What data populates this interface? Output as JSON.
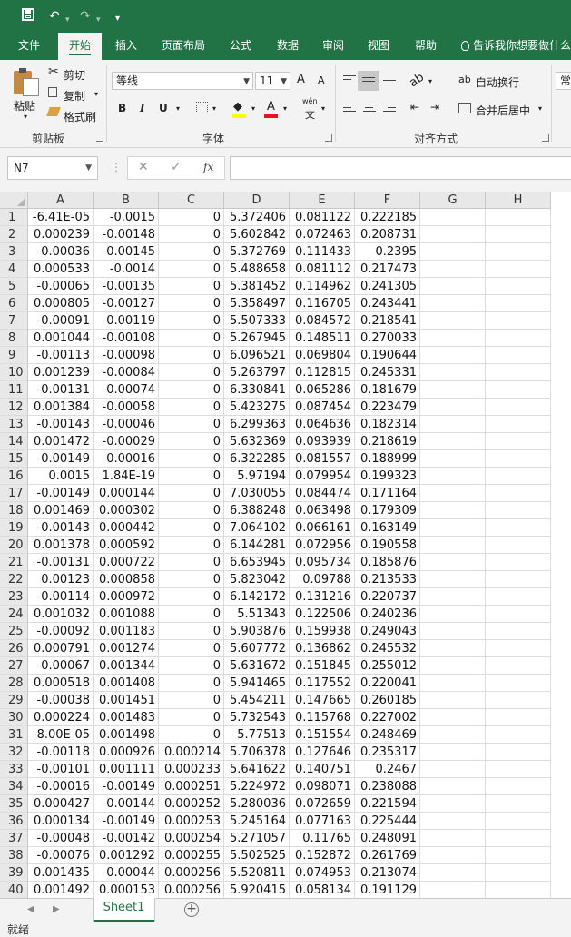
{
  "quick_access": {
    "undo": "↶",
    "redo": "↷",
    "customize": "▾"
  },
  "menu": {
    "tabs": [
      "文件",
      "开始",
      "插入",
      "页面布局",
      "公式",
      "数据",
      "审阅",
      "视图",
      "帮助"
    ],
    "active": "开始",
    "tell_me": "告诉我你想要做什么"
  },
  "ribbon": {
    "clipboard": {
      "paste": "粘贴",
      "cut": "剪切",
      "copy": "复制",
      "format_painter": "格式刷",
      "label": "剪贴板"
    },
    "font": {
      "name": "等线",
      "size": "11",
      "grow": "A",
      "shrink": "A",
      "bold": "B",
      "italic": "I",
      "underline": "U",
      "phonetic": "wén",
      "label": "字体"
    },
    "alignment": {
      "wrap_text": "自动换行",
      "merge_center": "合并后居中",
      "label": "对齐方式"
    },
    "number": {
      "format": "常规"
    }
  },
  "formula_bar": {
    "name_box": "N7",
    "cancel": "✕",
    "enter": "✓",
    "fx": "fx",
    "formula": ""
  },
  "grid": {
    "columns": [
      "A",
      "B",
      "C",
      "D",
      "E",
      "F",
      "G",
      "H"
    ],
    "rows": [
      [
        "-6.41E-05",
        "-0.0015",
        "0",
        "5.372406",
        "0.081122",
        "0.222185"
      ],
      [
        "0.000239",
        "-0.00148",
        "0",
        "5.602842",
        "0.072463",
        "0.208731"
      ],
      [
        "-0.00036",
        "-0.00145",
        "0",
        "5.372769",
        "0.111433",
        "0.2395"
      ],
      [
        "0.000533",
        "-0.0014",
        "0",
        "5.488658",
        "0.081112",
        "0.217473"
      ],
      [
        "-0.00065",
        "-0.00135",
        "0",
        "5.381452",
        "0.114962",
        "0.241305"
      ],
      [
        "0.000805",
        "-0.00127",
        "0",
        "5.358497",
        "0.116705",
        "0.243441"
      ],
      [
        "-0.00091",
        "-0.00119",
        "0",
        "5.507333",
        "0.084572",
        "0.218541"
      ],
      [
        "0.001044",
        "-0.00108",
        "0",
        "5.267945",
        "0.148511",
        "0.270033"
      ],
      [
        "-0.00113",
        "-0.00098",
        "0",
        "6.096521",
        "0.069804",
        "0.190644"
      ],
      [
        "0.001239",
        "-0.00084",
        "0",
        "5.263797",
        "0.112815",
        "0.245331"
      ],
      [
        "-0.00131",
        "-0.00074",
        "0",
        "6.330841",
        "0.065286",
        "0.181679"
      ],
      [
        "0.001384",
        "-0.00058",
        "0",
        "5.423275",
        "0.087454",
        "0.223479"
      ],
      [
        "-0.00143",
        "-0.00046",
        "0",
        "6.299363",
        "0.064636",
        "0.182314"
      ],
      [
        "0.001472",
        "-0.00029",
        "0",
        "5.632369",
        "0.093939",
        "0.218619"
      ],
      [
        "-0.00149",
        "-0.00016",
        "0",
        "6.322285",
        "0.081557",
        "0.188999"
      ],
      [
        "0.0015",
        "1.84E-19",
        "0",
        "5.97194",
        "0.079954",
        "0.199323"
      ],
      [
        "-0.00149",
        "0.000144",
        "0",
        "7.030055",
        "0.084474",
        "0.171164"
      ],
      [
        "0.001469",
        "0.000302",
        "0",
        "6.388248",
        "0.063498",
        "0.179309"
      ],
      [
        "-0.00143",
        "0.000442",
        "0",
        "7.064102",
        "0.066161",
        "0.163149"
      ],
      [
        "0.001378",
        "0.000592",
        "0",
        "6.144281",
        "0.072956",
        "0.190558"
      ],
      [
        "-0.00131",
        "0.000722",
        "0",
        "6.653945",
        "0.095734",
        "0.185876"
      ],
      [
        "0.00123",
        "0.000858",
        "0",
        "5.823042",
        "0.09788",
        "0.213533"
      ],
      [
        "-0.00114",
        "0.000972",
        "0",
        "6.142172",
        "0.131216",
        "0.220737"
      ],
      [
        "0.001032",
        "0.001088",
        "0",
        "5.51343",
        "0.122506",
        "0.240236"
      ],
      [
        "-0.00092",
        "0.001183",
        "0",
        "5.903876",
        "0.159938",
        "0.249043"
      ],
      [
        "0.000791",
        "0.001274",
        "0",
        "5.607772",
        "0.136862",
        "0.245532"
      ],
      [
        "-0.00067",
        "0.001344",
        "0",
        "5.631672",
        "0.151845",
        "0.255012"
      ],
      [
        "0.000518",
        "0.001408",
        "0",
        "5.941465",
        "0.117552",
        "0.220041"
      ],
      [
        "-0.00038",
        "0.001451",
        "0",
        "5.454211",
        "0.147665",
        "0.260185"
      ],
      [
        "0.000224",
        "0.001483",
        "0",
        "5.732543",
        "0.115768",
        "0.227002"
      ],
      [
        "-8.00E-05",
        "0.001498",
        "0",
        "5.77513",
        "0.151554",
        "0.248469"
      ],
      [
        "-0.00118",
        "0.000926",
        "0.000214",
        "5.706378",
        "0.127646",
        "0.235317"
      ],
      [
        "-0.00101",
        "0.001111",
        "0.000233",
        "5.641622",
        "0.140751",
        "0.2467"
      ],
      [
        "-0.00016",
        "-0.00149",
        "0.000251",
        "5.224972",
        "0.098071",
        "0.238088"
      ],
      [
        "0.000427",
        "-0.00144",
        "0.000252",
        "5.280036",
        "0.072659",
        "0.221594"
      ],
      [
        "0.000134",
        "-0.00149",
        "0.000253",
        "5.245164",
        "0.077163",
        "0.225444"
      ],
      [
        "-0.00048",
        "-0.00142",
        "0.000254",
        "5.271057",
        "0.11765",
        "0.248091"
      ],
      [
        "-0.00076",
        "0.001292",
        "0.000255",
        "5.502525",
        "0.152872",
        "0.261769"
      ],
      [
        "0.001435",
        "-0.00044",
        "0.000256",
        "5.520811",
        "0.074953",
        "0.213074"
      ],
      [
        "0.001492",
        "0.000153",
        "0.000256",
        "5.920415",
        "0.058134",
        "0.191129"
      ]
    ]
  },
  "sheets": {
    "tabs": [
      "Sheet1"
    ],
    "add": "+"
  },
  "status": {
    "text": "就绪"
  },
  "colors": {
    "brand": "#217346"
  }
}
